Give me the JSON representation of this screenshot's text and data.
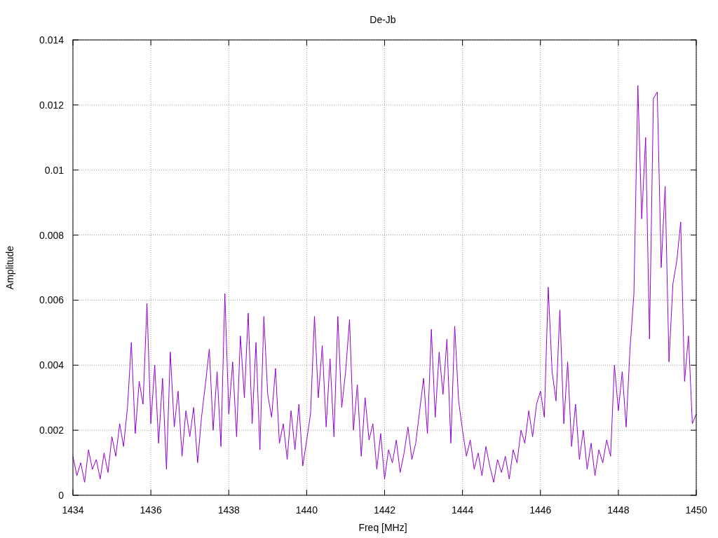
{
  "plot": {
    "chart_data": {
      "type": "line",
      "title": "De-Jb",
      "xlabel": "Freq [MHz]",
      "ylabel": "Amplitude",
      "grid": true,
      "xlim": [
        1434,
        1450
      ],
      "ylim": [
        0,
        0.014
      ],
      "xticks": [
        1434,
        1436,
        1438,
        1440,
        1442,
        1444,
        1446,
        1448,
        1450
      ],
      "yticks": [
        0.014,
        0.012,
        0.01,
        0.008,
        0.006,
        0.004,
        0.002,
        0
      ],
      "x": [
        1434.0,
        1434.1,
        1434.2,
        1434.3,
        1434.4,
        1434.5,
        1434.6,
        1434.7,
        1434.8,
        1434.9,
        1435.0,
        1435.1,
        1435.2,
        1435.3,
        1435.4,
        1435.5,
        1435.6,
        1435.7,
        1435.8,
        1435.9,
        1436.0,
        1436.1,
        1436.2,
        1436.3,
        1436.4,
        1436.5,
        1436.6,
        1436.7,
        1436.8,
        1436.9,
        1437.0,
        1437.1,
        1437.2,
        1437.3,
        1437.4,
        1437.5,
        1437.6,
        1437.7,
        1437.8,
        1437.9,
        1438.0,
        1438.1,
        1438.2,
        1438.3,
        1438.4,
        1438.5,
        1438.6,
        1438.7,
        1438.8,
        1438.9,
        1439.0,
        1439.1,
        1439.2,
        1439.3,
        1439.4,
        1439.5,
        1439.6,
        1439.7,
        1439.8,
        1439.9,
        1440.0,
        1440.1,
        1440.2,
        1440.3,
        1440.4,
        1440.5,
        1440.6,
        1440.7,
        1440.8,
        1440.9,
        1441.0,
        1441.1,
        1441.2,
        1441.3,
        1441.4,
        1441.5,
        1441.6,
        1441.7,
        1441.8,
        1441.9,
        1442.0,
        1442.1,
        1442.2,
        1442.3,
        1442.4,
        1442.5,
        1442.6,
        1442.7,
        1442.8,
        1442.9,
        1443.0,
        1443.1,
        1443.2,
        1443.3,
        1443.4,
        1443.5,
        1443.6,
        1443.7,
        1443.8,
        1443.9,
        1444.0,
        1444.1,
        1444.2,
        1444.3,
        1444.4,
        1444.5,
        1444.6,
        1444.7,
        1444.8,
        1444.9,
        1445.0,
        1445.1,
        1445.2,
        1445.3,
        1445.4,
        1445.5,
        1445.6,
        1445.7,
        1445.8,
        1445.9,
        1446.0,
        1446.1,
        1446.2,
        1446.3,
        1446.4,
        1446.5,
        1446.6,
        1446.7,
        1446.8,
        1446.9,
        1447.0,
        1447.1,
        1447.2,
        1447.3,
        1447.4,
        1447.5,
        1447.6,
        1447.7,
        1447.8,
        1447.9,
        1448.0,
        1448.1,
        1448.2,
        1448.3,
        1448.4,
        1448.5,
        1448.6,
        1448.7,
        1448.8,
        1448.9,
        1449.0,
        1449.1,
        1449.2,
        1449.3,
        1449.4,
        1449.5,
        1449.6,
        1449.7,
        1449.8,
        1449.9,
        1450.0
      ],
      "series": [
        {
          "color": "#9400d3",
          "values": [
            0.0012,
            0.0006,
            0.001,
            0.0004,
            0.0014,
            0.0008,
            0.0011,
            0.0005,
            0.0013,
            0.0007,
            0.0018,
            0.0012,
            0.0022,
            0.0015,
            0.0027,
            0.0047,
            0.0019,
            0.0035,
            0.0028,
            0.0059,
            0.0022,
            0.004,
            0.0016,
            0.0036,
            0.0008,
            0.0044,
            0.0021,
            0.0032,
            0.0012,
            0.0026,
            0.0018,
            0.0027,
            0.001,
            0.0024,
            0.0034,
            0.0045,
            0.002,
            0.0038,
            0.0015,
            0.0062,
            0.0025,
            0.0041,
            0.0018,
            0.0049,
            0.003,
            0.0056,
            0.0022,
            0.0047,
            0.0014,
            0.0055,
            0.0031,
            0.0024,
            0.0039,
            0.0016,
            0.0022,
            0.0011,
            0.0026,
            0.0014,
            0.0028,
            0.0009,
            0.0017,
            0.0025,
            0.0055,
            0.003,
            0.0046,
            0.0021,
            0.0042,
            0.0018,
            0.0055,
            0.0027,
            0.0038,
            0.0054,
            0.002,
            0.0034,
            0.0012,
            0.003,
            0.0017,
            0.0022,
            0.0008,
            0.0019,
            0.0005,
            0.0014,
            0.001,
            0.0017,
            0.0007,
            0.0013,
            0.0021,
            0.0011,
            0.0016,
            0.0026,
            0.0036,
            0.0019,
            0.0051,
            0.0024,
            0.0044,
            0.0031,
            0.0048,
            0.0016,
            0.0052,
            0.0029,
            0.002,
            0.0012,
            0.0017,
            0.0008,
            0.0013,
            0.0006,
            0.0015,
            0.0009,
            0.0004,
            0.0011,
            0.0007,
            0.0012,
            0.0005,
            0.0014,
            0.001,
            0.002,
            0.0016,
            0.0026,
            0.0018,
            0.0028,
            0.0032,
            0.0024,
            0.0064,
            0.0038,
            0.0029,
            0.0057,
            0.0022,
            0.0041,
            0.0015,
            0.0028,
            0.0011,
            0.002,
            0.0008,
            0.0016,
            0.0006,
            0.0014,
            0.001,
            0.0017,
            0.0012,
            0.004,
            0.0026,
            0.0038,
            0.0021,
            0.0045,
            0.0062,
            0.0126,
            0.0085,
            0.011,
            0.0048,
            0.0122,
            0.0124,
            0.007,
            0.0095,
            0.0041,
            0.0065,
            0.0072,
            0.0084,
            0.0035,
            0.0049,
            0.0022,
            0.0025
          ]
        }
      ]
    }
  }
}
